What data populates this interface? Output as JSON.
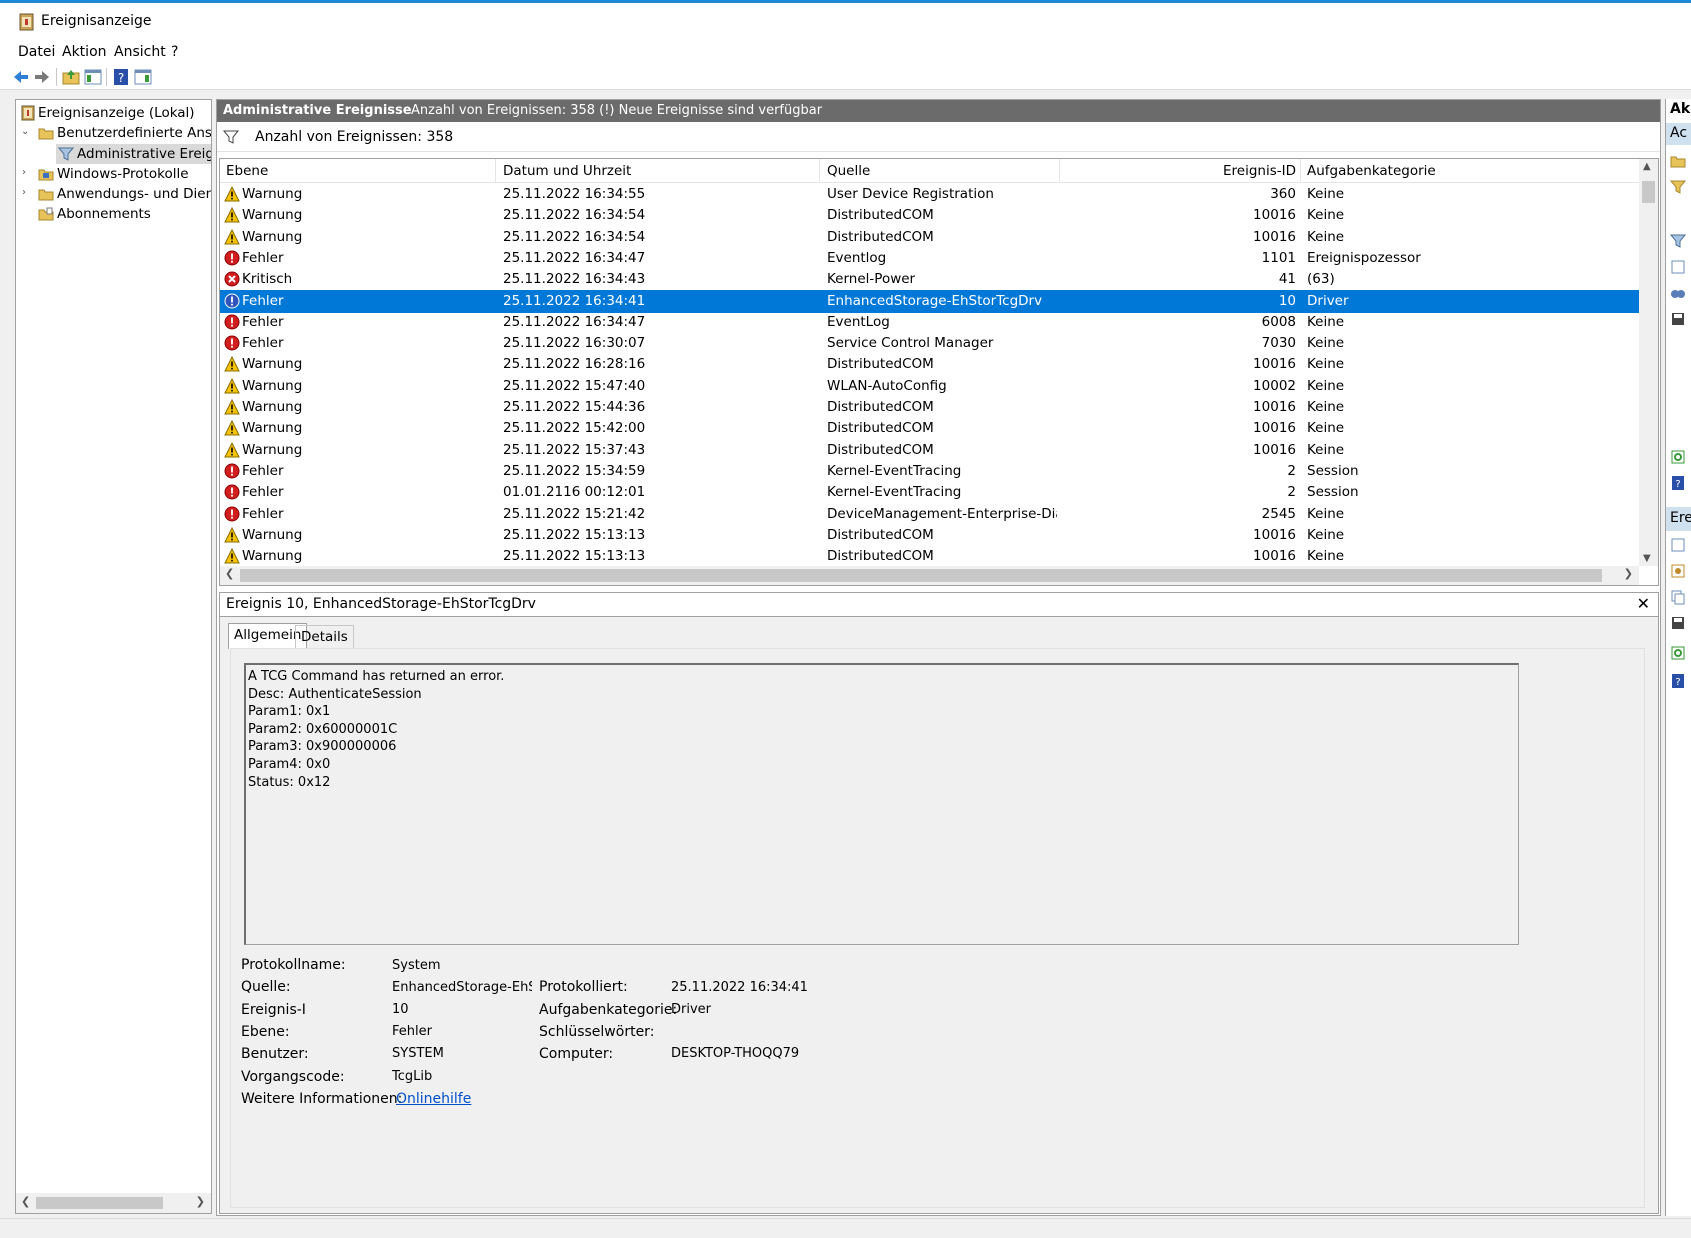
{
  "window": {
    "title": "Ereignisanzeige"
  },
  "menu": [
    "Datei",
    "Aktion",
    "Ansicht",
    "?"
  ],
  "tree": {
    "root": "Ereignisanzeige (Lokal)",
    "custom_views": "Benutzerdefinierte Ansic",
    "admin_events": "Administrative Ereigr",
    "windows_logs": "Windows-Protokolle",
    "app_logs": "Anwendungs- und Dien:",
    "subscriptions": "Abonnements"
  },
  "header": {
    "title": "Administrative Ereignisse",
    "info": "Anzahl von Ereignissen: 358 (!) Neue Ereignisse sind verfügbar"
  },
  "filter_text": "Anzahl von Ereignissen: 358",
  "columns": {
    "level": "Ebene",
    "date": "Datum und Uhrzeit",
    "source": "Quelle",
    "id": "Ereignis-ID",
    "category": "Aufgabenkategorie"
  },
  "events": [
    {
      "level": "Warnung",
      "type": "warning",
      "date": "25.11.2022 16:34:55",
      "source": "User Device Registration",
      "id": "360",
      "category": "Keine"
    },
    {
      "level": "Warnung",
      "type": "warning",
      "date": "25.11.2022 16:34:54",
      "source": "DistributedCOM",
      "id": "10016",
      "category": "Keine"
    },
    {
      "level": "Warnung",
      "type": "warning",
      "date": "25.11.2022 16:34:54",
      "source": "DistributedCOM",
      "id": "10016",
      "category": "Keine"
    },
    {
      "level": "Fehler",
      "type": "error",
      "date": "25.11.2022 16:34:47",
      "source": "Eventlog",
      "id": "1101",
      "category": "Ereignispozessor"
    },
    {
      "level": "Kritisch",
      "type": "critical",
      "date": "25.11.2022 16:34:43",
      "source": "Kernel-Power",
      "id": "41",
      "category": "(63)"
    },
    {
      "level": "Fehler",
      "type": "error",
      "date": "25.11.2022 16:34:41",
      "source": "EnhancedStorage-EhStorTcgDrv",
      "id": "10",
      "category": "Driver",
      "selected": true
    },
    {
      "level": "Fehler",
      "type": "error",
      "date": "25.11.2022 16:34:47",
      "source": "EventLog",
      "id": "6008",
      "category": "Keine"
    },
    {
      "level": "Fehler",
      "type": "error",
      "date": "25.11.2022 16:30:07",
      "source": "Service Control Manager",
      "id": "7030",
      "category": "Keine"
    },
    {
      "level": "Warnung",
      "type": "warning",
      "date": "25.11.2022 16:28:16",
      "source": "DistributedCOM",
      "id": "10016",
      "category": "Keine"
    },
    {
      "level": "Warnung",
      "type": "warning",
      "date": "25.11.2022 15:47:40",
      "source": "WLAN-AutoConfig",
      "id": "10002",
      "category": "Keine"
    },
    {
      "level": "Warnung",
      "type": "warning",
      "date": "25.11.2022 15:44:36",
      "source": "DistributedCOM",
      "id": "10016",
      "category": "Keine"
    },
    {
      "level": "Warnung",
      "type": "warning",
      "date": "25.11.2022 15:42:00",
      "source": "DistributedCOM",
      "id": "10016",
      "category": "Keine"
    },
    {
      "level": "Warnung",
      "type": "warning",
      "date": "25.11.2022 15:37:43",
      "source": "DistributedCOM",
      "id": "10016",
      "category": "Keine"
    },
    {
      "level": "Fehler",
      "type": "error",
      "date": "25.11.2022 15:34:59",
      "source": "Kernel-EventTracing",
      "id": "2",
      "category": "Session"
    },
    {
      "level": "Fehler",
      "type": "error",
      "date": "01.01.2116 00:12:01",
      "source": "Kernel-EventTracing",
      "id": "2",
      "category": "Session"
    },
    {
      "level": "Fehler",
      "type": "error",
      "date": "25.11.2022 15:21:42",
      "source": "DeviceManagement-Enterprise-Diagn…",
      "id": "2545",
      "category": "Keine"
    },
    {
      "level": "Warnung",
      "type": "warning",
      "date": "25.11.2022 15:13:13",
      "source": "DistributedCOM",
      "id": "10016",
      "category": "Keine"
    },
    {
      "level": "Warnung",
      "type": "warning",
      "date": "25.11.2022 15:13:13",
      "source": "DistributedCOM",
      "id": "10016",
      "category": "Keine"
    }
  ],
  "detail": {
    "title": "Ereignis 10, EnhancedStorage-EhStorTcgDrv",
    "tab_general": "Allgemein",
    "tab_details": "Details",
    "description": [
      "A TCG Command has returned an error.",
      "Desc: AuthenticateSession",
      "Param1: 0x1",
      "Param2: 0x60000001C",
      "Param3: 0x900000006",
      "Param4: 0x0",
      "Status: 0x12"
    ],
    "labels": {
      "log_name": "Protokollname:",
      "source": "Quelle:",
      "event_id": "Ereignis-I",
      "level": "Ebene:",
      "user": "Benutzer:",
      "opcode": "Vorgangscode:",
      "more_info": "Weitere Informationen:",
      "logged": "Protokolliert:",
      "task_category": "Aufgabenkategorie:",
      "keywords": "Schlüsselwörter:",
      "computer": "Computer:"
    },
    "values": {
      "log_name": "System",
      "source": "EnhancedStorage-EhStor",
      "event_id": "10",
      "level": "Fehler",
      "user": "SYSTEM",
      "opcode": "TcgLib",
      "more_info_link": "Onlinehilfe",
      "logged": "25.11.2022 16:34:41",
      "task_category": "Driver",
      "keywords": "",
      "computer": "DESKTOP-THOQQ79"
    }
  },
  "actions": {
    "header": "Ak",
    "sub1": "Ac",
    "sub2": "Ere"
  }
}
